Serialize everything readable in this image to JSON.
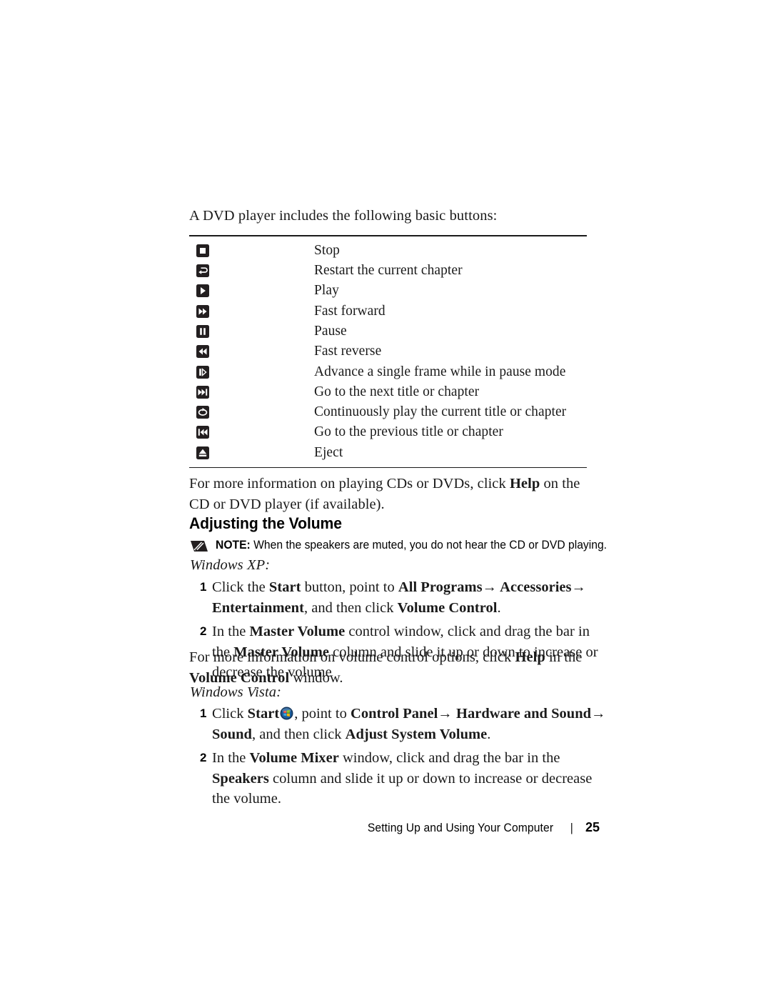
{
  "document": {
    "intro": "A DVD player includes the following basic buttons:",
    "buttons_table": {
      "rows": [
        {
          "icon": "stop-icon",
          "description": "Stop"
        },
        {
          "icon": "restart-chapter-icon",
          "description": "Restart the current chapter"
        },
        {
          "icon": "play-icon",
          "description": "Play"
        },
        {
          "icon": "fast-forward-icon",
          "description": "Fast forward"
        },
        {
          "icon": "pause-icon",
          "description": "Pause"
        },
        {
          "icon": "fast-reverse-icon",
          "description": "Fast reverse"
        },
        {
          "icon": "frame-advance-icon",
          "description": "Advance a single frame while in pause mode"
        },
        {
          "icon": "next-title-icon",
          "description": "Go to the next title or chapter"
        },
        {
          "icon": "repeat-icon",
          "description": "Continuously play the current title or chapter"
        },
        {
          "icon": "previous-title-icon",
          "description": "Go to the previous title or chapter"
        },
        {
          "icon": "eject-icon",
          "description": "Eject"
        }
      ]
    },
    "help_paragraph": {
      "part1": "For more information on playing CDs or DVDs, click ",
      "bold1": "Help",
      "part2": " on the CD or DVD player (if available)."
    },
    "heading": "Adjusting the Volume",
    "note": {
      "label": "NOTE:",
      "text": " When the speakers are muted, you do not hear the CD or DVD playing."
    },
    "windows_xp": {
      "label": "Windows XP:",
      "steps": [
        {
          "number": "1",
          "segments": [
            {
              "text": "Click the ",
              "bold": false
            },
            {
              "text": "Start",
              "bold": true
            },
            {
              "text": " button, point to ",
              "bold": false
            },
            {
              "text": "All Programs→ Accessories→ Entertainment",
              "bold": true
            },
            {
              "text": ", and then click ",
              "bold": false
            },
            {
              "text": "Volume Control",
              "bold": true
            },
            {
              "text": ".",
              "bold": false
            }
          ]
        },
        {
          "number": "2",
          "segments": [
            {
              "text": "In the ",
              "bold": false
            },
            {
              "text": "Master Volume",
              "bold": true
            },
            {
              "text": " control window, click and drag the bar in the ",
              "bold": false
            },
            {
              "text": "Master Volume",
              "bold": true
            },
            {
              "text": " column and slide it up or down to increase or decrease the volume",
              "bold": false
            }
          ]
        }
      ]
    },
    "volume_paragraph": {
      "part1": "For more information on volume control options, click ",
      "bold1": "Help",
      "part2": " in the ",
      "bold2": "Volume Control",
      "part3": " window."
    },
    "windows_vista": {
      "label": "Windows Vista:",
      "steps": [
        {
          "number": "1",
          "segments": [
            {
              "text": "Click ",
              "bold": false
            },
            {
              "text": "Start",
              "bold": true
            },
            {
              "text": "__ORB__",
              "bold": false
            },
            {
              "text": ", point to ",
              "bold": false
            },
            {
              "text": "Control Panel→ Hardware and Sound→ Sound",
              "bold": true
            },
            {
              "text": ", and then click ",
              "bold": false
            },
            {
              "text": "Adjust System Volume",
              "bold": true
            },
            {
              "text": ".",
              "bold": false
            }
          ]
        },
        {
          "number": "2",
          "segments": [
            {
              "text": "In the ",
              "bold": false
            },
            {
              "text": "Volume Mixer",
              "bold": true
            },
            {
              "text": " window, click and drag the bar in the ",
              "bold": false
            },
            {
              "text": "Speakers",
              "bold": true
            },
            {
              "text": " column and slide it up or down to increase or decrease the volume.",
              "bold": false
            }
          ]
        }
      ]
    },
    "footer": {
      "chapter": "Setting Up and Using Your Computer",
      "separator": "|",
      "page_number": "25"
    },
    "colors": {
      "text": "#1a1a1a",
      "icon_chip": "#231f20",
      "orb_blue": "#1b4f8a",
      "orb_red": "#e8453c",
      "orb_green": "#7ab800",
      "orb_lightblue": "#3aa8e0",
      "orb_yellow": "#f5b800"
    }
  }
}
